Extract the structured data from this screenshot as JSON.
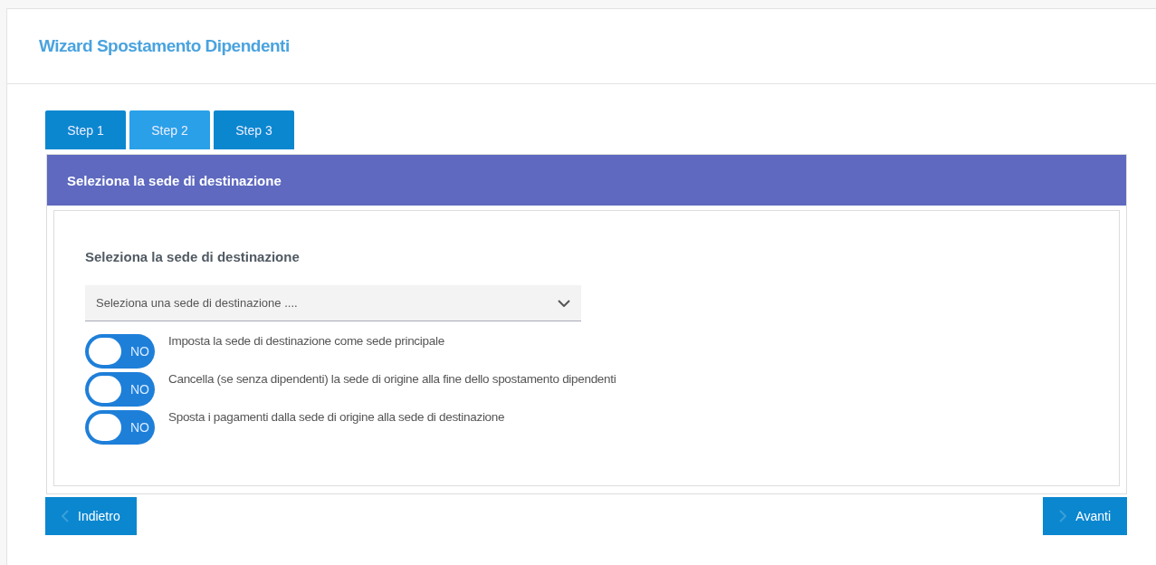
{
  "page": {
    "title": "Wizard Spostamento Dipendenti"
  },
  "tabs": [
    {
      "label": "Step 1",
      "selected": false
    },
    {
      "label": "Step 2",
      "selected": true
    },
    {
      "label": "Step 3",
      "selected": false
    }
  ],
  "panel": {
    "title": "Seleziona la sede di destinazione",
    "section_title": "Seleziona la sede di destinazione",
    "select": {
      "placeholder": "Seleziona una sede di destinazione ...."
    },
    "options": [
      {
        "label": "Imposta la sede di destinazione come sede principale",
        "on": false,
        "switch_text": "NO"
      },
      {
        "label": "Cancella (se senza dipendenti) la sede di origine alla fine dello spostamento dipendenti",
        "on": false,
        "switch_text": "NO"
      },
      {
        "label": "Sposta i pagamenti dalla sede di origine alla sede di destinazione",
        "on": false,
        "switch_text": "NO"
      }
    ]
  },
  "buttons": {
    "back": "Indietro",
    "next": "Avanti"
  }
}
